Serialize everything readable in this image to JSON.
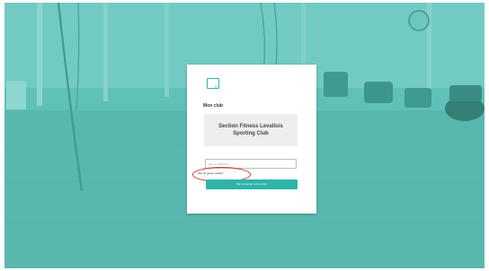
{
  "card": {
    "back_icon": "arrow-left-icon",
    "back_glyph": "←",
    "title": "Mon club",
    "club_name": "Section Fitness Levallois Sporting Club",
    "input_placeholder": "Mon email/GCFit",
    "help_link": "Mot de passe oublié?",
    "submit_label": "Me connecter à mon club",
    "accent_color": "#2fb4aa",
    "annotation_color": "#d9312b"
  },
  "background": {
    "tint_color": "#5fc1b7",
    "description": "gym interior with ropes and equipment"
  }
}
